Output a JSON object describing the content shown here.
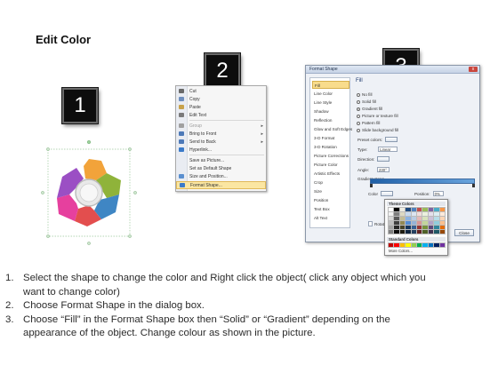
{
  "title": "Edit Color",
  "badges": [
    "1",
    "2",
    "3"
  ],
  "context_menu": {
    "items": [
      {
        "label": "Cut",
        "icon": "scissors-icon",
        "color": "#6a6a6a",
        "disabled": false
      },
      {
        "label": "Copy",
        "icon": "copy-icon",
        "color": "#6f8fbf",
        "disabled": false
      },
      {
        "label": "Paste",
        "icon": "paste-icon",
        "color": "#c8a24a",
        "disabled": false
      },
      {
        "label": "Edit Text",
        "icon": "text-icon",
        "color": "#7a7a7a",
        "disabled": false
      },
      {
        "label": "Group",
        "icon": "group-icon",
        "color": "#a0a0a0",
        "disabled": true,
        "submenu": true
      },
      {
        "label": "Bring to Front",
        "icon": "bring-front-icon",
        "color": "#4d79b8",
        "disabled": false,
        "submenu": true
      },
      {
        "label": "Send to Back",
        "icon": "send-back-icon",
        "color": "#4d79b8",
        "disabled": false,
        "submenu": true
      },
      {
        "label": "Hyperlink...",
        "icon": "link-icon",
        "color": "#3a7ac9",
        "disabled": false
      },
      {
        "label": "Save as Picture...",
        "icon": "",
        "color": "",
        "disabled": false
      },
      {
        "label": "Set as Default Shape",
        "icon": "",
        "color": "",
        "disabled": false
      },
      {
        "label": "Size and Position...",
        "icon": "size-icon",
        "color": "#5a8fcf",
        "disabled": false
      },
      {
        "label": "Format Shape...",
        "icon": "format-shape-icon",
        "color": "#3a7ac9",
        "disabled": false,
        "highlighted": true
      }
    ]
  },
  "dialog": {
    "title": "Format Shape",
    "close_label": "x",
    "nav": [
      "Fill",
      "Line Color",
      "Line Style",
      "Shadow",
      "Reflection",
      "Glow and Soft Edges",
      "3-D Format",
      "3-D Rotation",
      "Picture Corrections",
      "Picture Color",
      "Artistic Effects",
      "Crop",
      "Size",
      "Position",
      "Text Box",
      "Alt Text"
    ],
    "pane_title": "Fill",
    "fill_options": [
      "No fill",
      "Solid fill",
      "Gradient fill",
      "Picture or texture fill",
      "Pattern fill",
      "Slide background fill"
    ],
    "selected_fill": 2,
    "preset_label": "Preset colors:",
    "type_label": "Type:",
    "type_value": "Linear",
    "direction_label": "Direction:",
    "angle_label": "Angle:",
    "angle_value": "230°",
    "stops_label": "Gradient stops",
    "color_label": "Color",
    "position_label": "Position:",
    "position_value": "0%",
    "brightness_label": "Brightness",
    "transparency_label": "Transparen",
    "rotate_label": "Rotate",
    "close_button": "Close"
  },
  "palette": {
    "theme_label": "Theme Colors",
    "standard_label": "Standard Colors",
    "more_label": "More Colors...",
    "theme_colors": [
      "#ffffff",
      "#000000",
      "#eeece1",
      "#1f497d",
      "#4f81bd",
      "#c0504d",
      "#9bbb59",
      "#8064a2",
      "#4bacc6",
      "#f79646",
      "#f2f2f2",
      "#7f7f7f",
      "#ddd9c3",
      "#c6d9f0",
      "#dbe5f1",
      "#f2dcdb",
      "#ebf1dd",
      "#e5e0ec",
      "#dbeef3",
      "#fdeada",
      "#d8d8d8",
      "#595959",
      "#c4bd97",
      "#8db3e2",
      "#b8cce4",
      "#e5b9b7",
      "#d7e3bc",
      "#ccc1d9",
      "#b7dde8",
      "#fbd5b5",
      "#bfbfbf",
      "#3f3f3f",
      "#938953",
      "#548dd4",
      "#95b3d7",
      "#d99694",
      "#c3d69b",
      "#b2a2c7",
      "#92cddc",
      "#fac08f",
      "#a5a5a5",
      "#262626",
      "#494429",
      "#17365d",
      "#366092",
      "#953734",
      "#76923c",
      "#5f497a",
      "#31859b",
      "#e36c09",
      "#7f7f7f",
      "#0c0c0c",
      "#1d1b10",
      "#0f243e",
      "#244061",
      "#632423",
      "#4f6128",
      "#3f3151",
      "#205867",
      "#974806"
    ],
    "standard_colors": [
      "#c00000",
      "#ff0000",
      "#ffc000",
      "#ffff00",
      "#92d050",
      "#00b050",
      "#00b0f0",
      "#0070c0",
      "#002060",
      "#7030a0"
    ]
  },
  "instructions": [
    {
      "num": "1.",
      "text": "Select the shape to change the color and Right click the object( click any object which you"
    },
    {
      "num": "",
      "text": "want to change color)"
    },
    {
      "num": "2.",
      "text": "Choose Format Shape in the dialog box."
    },
    {
      "num": "3.",
      "text": "Choose “Fill” in the Format Shape box then “Solid” or “Gradient” depending on the"
    },
    {
      "num": "",
      "text": "appearance of the object. Change colour as shown in the picture."
    }
  ]
}
